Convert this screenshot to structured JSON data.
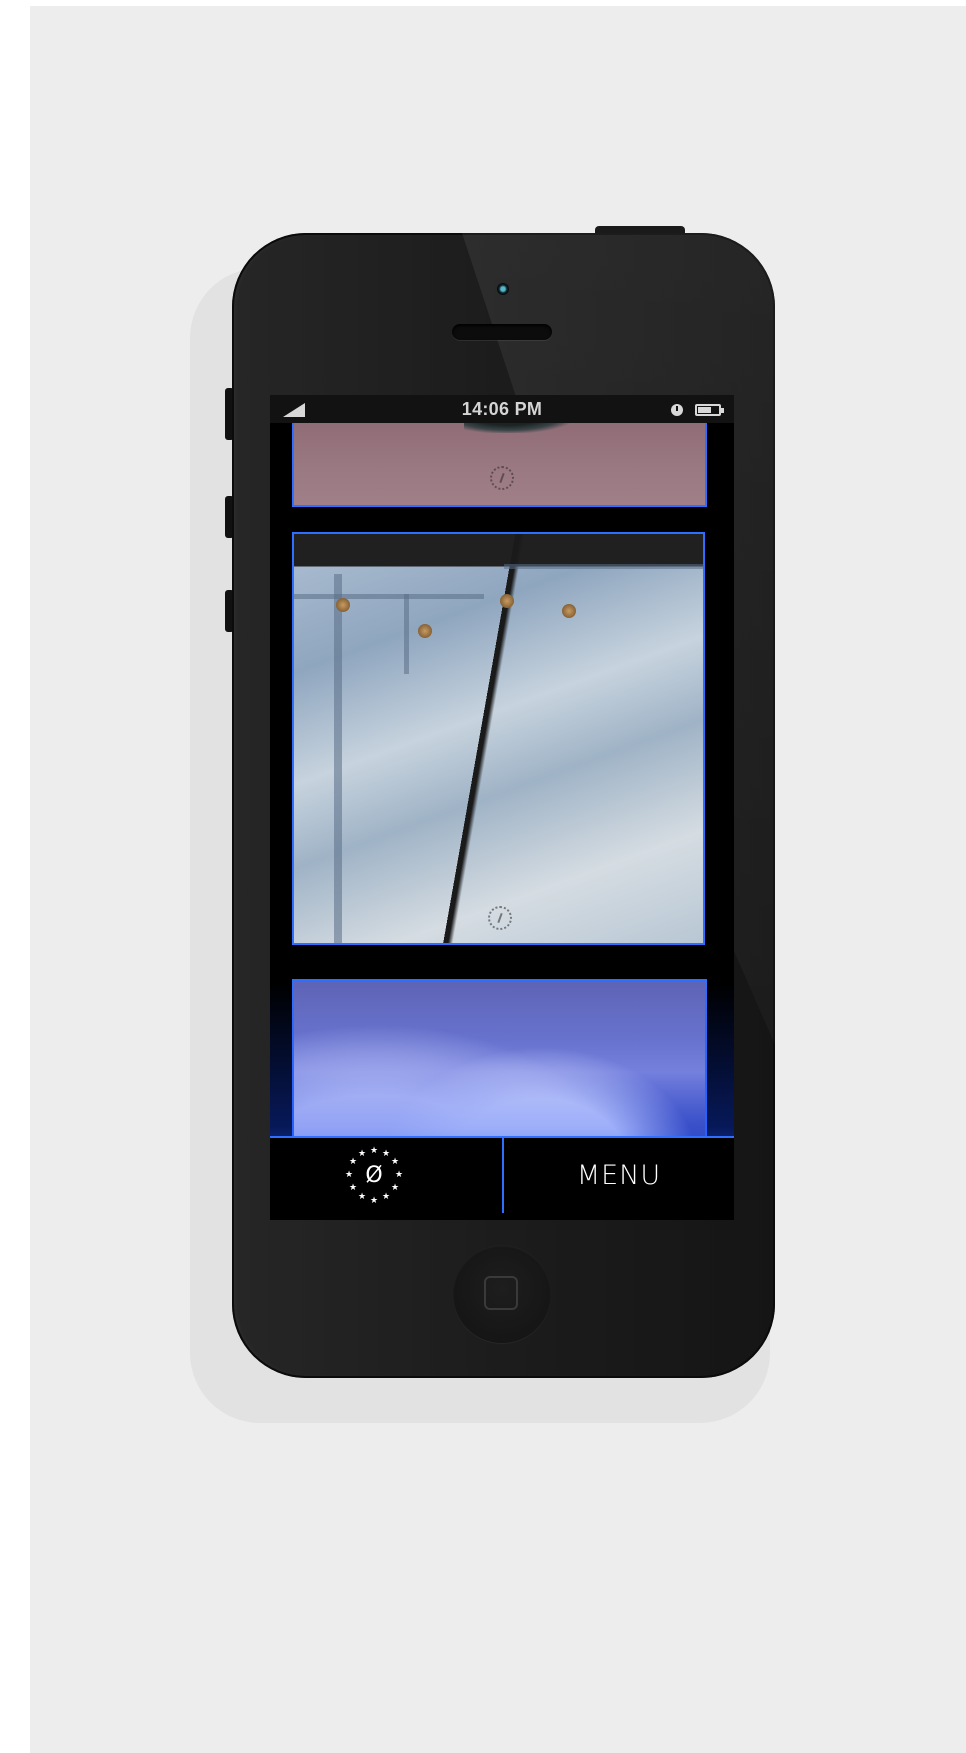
{
  "status_bar": {
    "time": "14:06 PM",
    "signal_icon": "signal-icon",
    "alarm_icon": "alarm-icon",
    "battery_icon": "battery-icon"
  },
  "feed": {
    "cards": [
      {
        "image": "tattoo on skin",
        "watermark_icon": "logo-watermark-icon"
      },
      {
        "image": "denim jeans close-up",
        "watermark_icon": "logo-watermark-icon"
      },
      {
        "image": "blue-toned clouds landscape"
      }
    ]
  },
  "tab_bar": {
    "logo_glyph": "Ø",
    "logo_icon": "star-circle-logo-icon",
    "menu_label": "MENU"
  },
  "colors": {
    "accent": "#2f6fff",
    "background": "#ededed",
    "phone_body": "#1c1c1c"
  }
}
